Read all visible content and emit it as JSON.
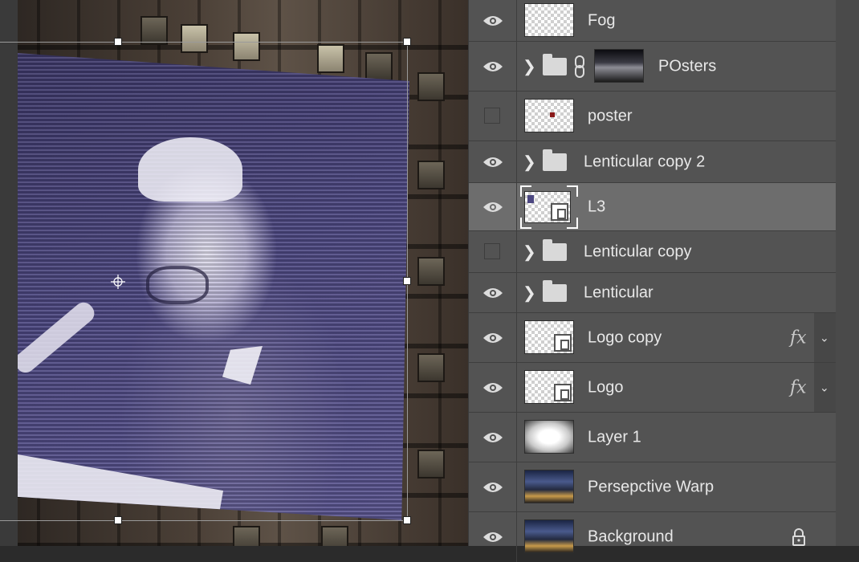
{
  "layers": [
    {
      "name": "Fog",
      "visible": true,
      "kind": "layer",
      "thumb": "checker"
    },
    {
      "name": "POsters",
      "visible": true,
      "kind": "group-linked",
      "thumb": "photo-dark"
    },
    {
      "name": "poster",
      "visible": false,
      "kind": "layer",
      "thumb": "checker"
    },
    {
      "name": "Lenticular copy 2",
      "visible": true,
      "kind": "group"
    },
    {
      "name": "L3",
      "visible": true,
      "kind": "smart-object",
      "selected": true
    },
    {
      "name": "Lenticular copy",
      "visible": false,
      "kind": "group"
    },
    {
      "name": "Lenticular",
      "visible": true,
      "kind": "group"
    },
    {
      "name": "Logo copy",
      "visible": true,
      "kind": "smart-object",
      "fx": "fx"
    },
    {
      "name": "Logo",
      "visible": true,
      "kind": "smart-object",
      "fx": "fx"
    },
    {
      "name": "Layer 1",
      "visible": true,
      "kind": "layer",
      "thumb": "blur"
    },
    {
      "name": "Persepctive Warp",
      "visible": true,
      "kind": "layer",
      "thumb": "photo"
    },
    {
      "name": "Background",
      "visible": true,
      "kind": "layer",
      "thumb": "photo",
      "locked": true
    }
  ],
  "icons": {
    "visibility": "eye-icon",
    "group": "folder-icon",
    "expand": "chevron-right-icon",
    "link": "link-icon",
    "fx_menu": "chevron-down-icon",
    "lock": "lock-icon",
    "transform_center": "crosshair-icon"
  },
  "colors": {
    "panel_bg": "#535353",
    "selected_row": "#6d6d6d",
    "poster_tint": "#4c4781"
  }
}
